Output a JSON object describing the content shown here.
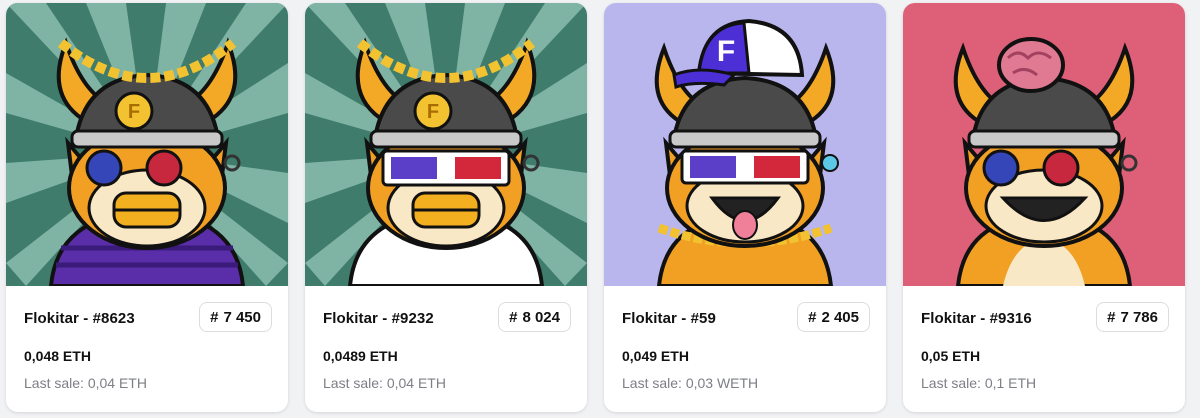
{
  "cards": [
    {
      "name": "Flokitar - #8623",
      "rank_symbol": "#",
      "rank": "7 450",
      "price": "0,048 ETH",
      "last_sale": "Last sale: 0,04 ETH",
      "background": "rays-green",
      "accessory": "gold-chain-crown",
      "eyes": "button-eyes",
      "outfit": "purple-striped-shirt"
    },
    {
      "name": "Flokitar - #9232",
      "rank_symbol": "#",
      "rank": "8 024",
      "price": "0,0489 ETH",
      "last_sale": "Last sale: 0,04 ETH",
      "background": "rays-green",
      "accessory": "gold-chain-crown",
      "eyes": "3d-glasses",
      "outfit": "white-shirt"
    },
    {
      "name": "Flokitar - #59",
      "rank_symbol": "#",
      "rank": "2 405",
      "price": "0,049 ETH",
      "last_sale": "Last sale: 0,03 WETH",
      "background": "lavender",
      "accessory": "purple-cap",
      "eyes": "3d-glasses",
      "outfit": "gold-chain-necklace"
    },
    {
      "name": "Flokitar - #9316",
      "rank_symbol": "#",
      "rank": "7 786",
      "price": "0,05 ETH",
      "last_sale": "Last sale: 0,1 ETH",
      "background": "pink",
      "accessory": "brain",
      "eyes": "button-eyes",
      "outfit": "none"
    }
  ],
  "colors": {
    "rays_dark": "#3f7c6b",
    "rays_light": "#7fb3a3",
    "lavender": "#b9b6ee",
    "pink": "#de6078",
    "fur": "#f1a024",
    "cream": "#f9e8c6",
    "helmet": "#4a4a4a",
    "horn": "#f3a826",
    "gold": "#f2c230"
  }
}
